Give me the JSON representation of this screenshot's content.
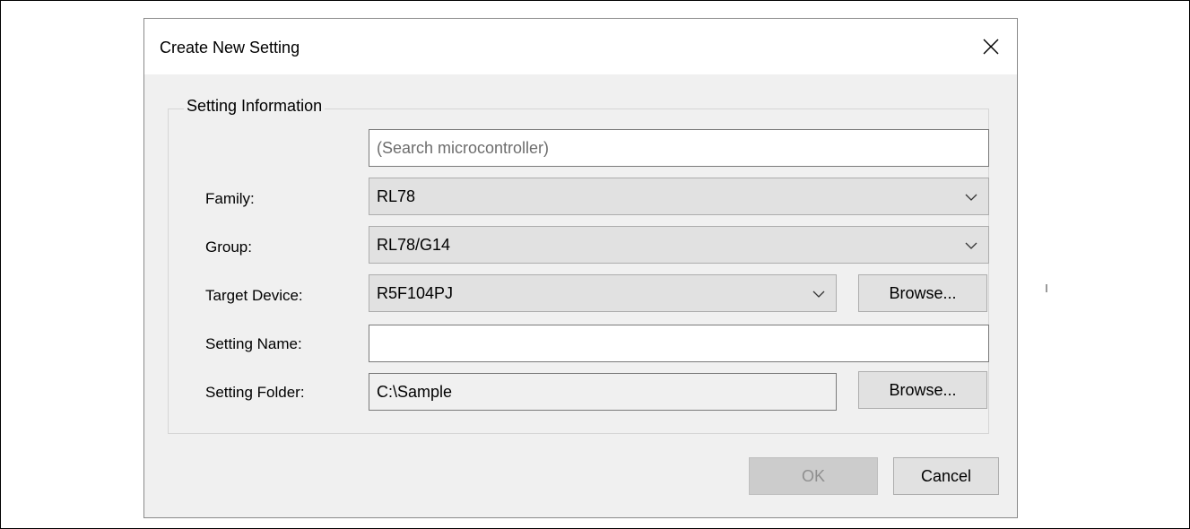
{
  "dialog": {
    "title": "Create New Setting",
    "close_icon": "close-icon"
  },
  "group": {
    "legend": "Setting Information"
  },
  "search": {
    "placeholder": "(Search microcontroller)",
    "value": ""
  },
  "family": {
    "label": "Family:",
    "value": "RL78"
  },
  "group_field": {
    "label": "Group:",
    "value": "RL78/G14"
  },
  "target_device": {
    "label": "Target Device:",
    "value": "R5F104PJ",
    "browse_label": "Browse..."
  },
  "setting_name": {
    "label": "Setting Name:",
    "value": ""
  },
  "setting_folder": {
    "label": "Setting Folder:",
    "value": "C:\\Sample",
    "browse_label": "Browse..."
  },
  "footer": {
    "ok_label": "OK",
    "ok_enabled": false,
    "cancel_label": "Cancel"
  },
  "colors": {
    "dialog_bg": "#f0f0f0",
    "titlebar_bg": "#ffffff",
    "combo_bg": "#e1e1e1",
    "disabled_button_bg": "#cccccc"
  }
}
